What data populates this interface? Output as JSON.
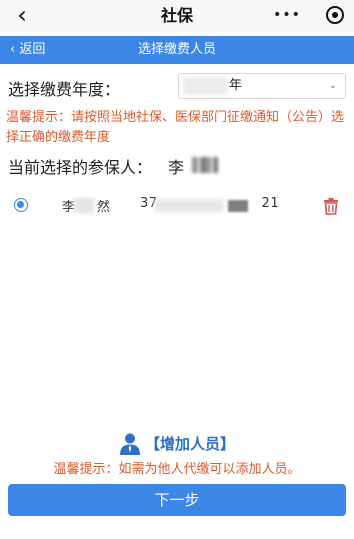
{
  "wechat_bar": {
    "title": "社保",
    "back_icon": "chevron-left-icon",
    "more_icon": "more-dots-icon",
    "close_icon": "target-close-icon"
  },
  "nav": {
    "back_label": "返回",
    "title": "选择缴费人员"
  },
  "year_selector": {
    "label": "选择缴费年度：",
    "value_suffix": "年"
  },
  "tip_year": "温馨提示：请按照当地社保、医保部门征缴通知（公告）选择正确的缴费年度",
  "insured": {
    "label": "当前选择的参保人：",
    "name": "李"
  },
  "persons": [
    {
      "name_first": "李",
      "name_last": "然",
      "id_prefix": "37",
      "id_suffix": "21",
      "selected": true
    }
  ],
  "add_person": {
    "label": "【增加人员】"
  },
  "tip_add": "温馨提示：如需为他人代缴可以添加人员。",
  "next_button": "下一步",
  "colors": {
    "primary": "#3c86e8",
    "warning": "#e05a2a",
    "delete": "#d9534f",
    "link": "#2f6fc4"
  }
}
